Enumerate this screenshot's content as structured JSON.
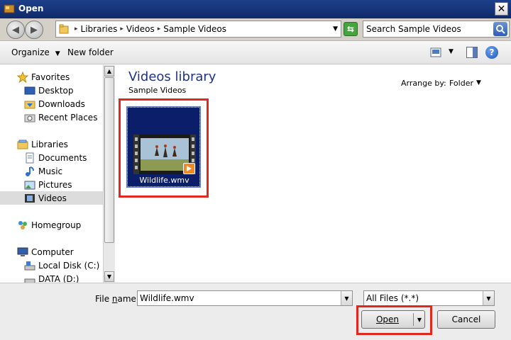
{
  "window": {
    "title": "Open",
    "close_glyph": "✕"
  },
  "address": {
    "crumbs": [
      "Libraries",
      "Videos",
      "Sample Videos"
    ],
    "separator": "▸",
    "search_placeholder": "Search Sample Videos"
  },
  "toolbar": {
    "organize_label": "Organize",
    "new_folder_label": "New folder"
  },
  "nav": {
    "favorites": "Favorites",
    "desktop": "Desktop",
    "downloads": "Downloads",
    "recent_places": "Recent Places",
    "libraries": "Libraries",
    "documents": "Documents",
    "music": "Music",
    "pictures": "Pictures",
    "videos": "Videos",
    "homegroup": "Homegroup",
    "computer": "Computer",
    "local_disk": "Local Disk (C:)",
    "data_drive": "DATA (D:)"
  },
  "content": {
    "title": "Videos library",
    "subtitle": "Sample Videos",
    "arrange_label": "Arrange by:",
    "arrange_value": "Folder",
    "files": [
      {
        "name": "Wildlife.wmv",
        "selected": true
      }
    ]
  },
  "bottom": {
    "file_name_label_first": "File ",
    "file_name_label_u": "n",
    "file_name_label_rest": "ame:",
    "file_name_value": "Wildlife.wmv",
    "file_type_value": "All Files (*.*)",
    "open_label": "Open",
    "cancel_label": "Cancel"
  },
  "colors": {
    "titlebar": "#1d3f8a",
    "library_title": "#1e3287",
    "selection_tile": "#0b1e6a",
    "highlight": "#e0281f"
  },
  "icons": [
    "back-arrow-icon",
    "forward-arrow-icon",
    "folder-icon",
    "refresh-icon",
    "search-icon",
    "view-icon",
    "preview-pane-icon",
    "help-icon",
    "star-icon",
    "desktop-icon",
    "downloads-icon",
    "recent-places-icon",
    "libraries-icon",
    "documents-icon",
    "music-icon",
    "pictures-icon",
    "videos-icon",
    "homegroup-icon",
    "computer-icon",
    "disk-icon",
    "play-icon"
  ]
}
